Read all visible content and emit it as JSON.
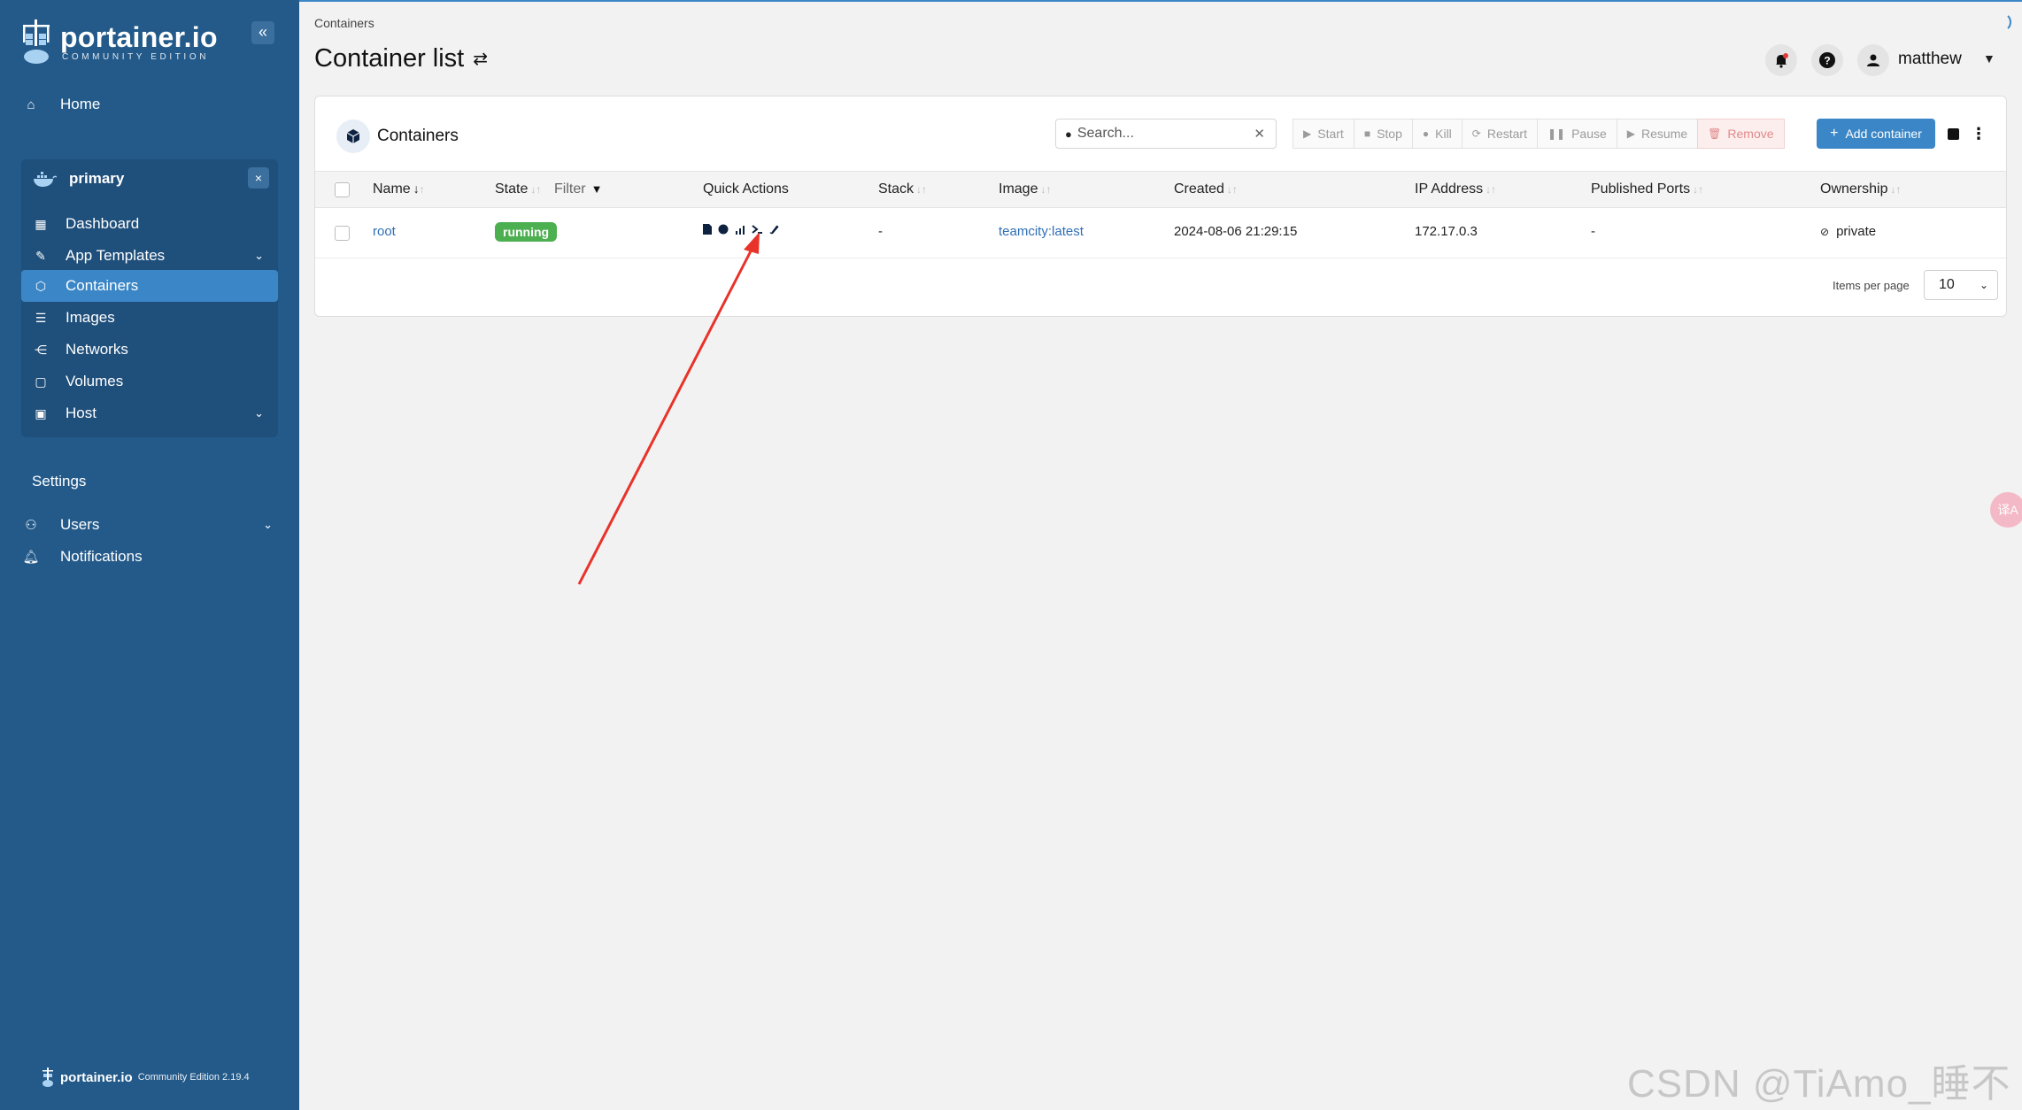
{
  "sidebar": {
    "logo_name": "portainer.io",
    "logo_sub": "COMMUNITY EDITION",
    "collapse_glyph": "«",
    "home_label": "Home",
    "environment": {
      "name": "primary",
      "close_glyph": "×",
      "items": [
        {
          "label": "Dashboard",
          "icon": "dashboard-icon"
        },
        {
          "label": "App Templates",
          "icon": "templates-icon",
          "expandable": true
        },
        {
          "label": "Containers",
          "icon": "cube-icon",
          "active": true
        },
        {
          "label": "Images",
          "icon": "list-icon"
        },
        {
          "label": "Networks",
          "icon": "network-icon"
        },
        {
          "label": "Volumes",
          "icon": "volume-icon"
        },
        {
          "label": "Host",
          "icon": "host-icon",
          "expandable": true
        }
      ]
    },
    "settings_title": "Settings",
    "settings_items": [
      {
        "label": "Users",
        "icon": "users-icon",
        "expandable": true
      },
      {
        "label": "Notifications",
        "icon": "bell-icon"
      }
    ],
    "footer": {
      "name": "portainer.io",
      "version": "Community Edition 2.19.4"
    }
  },
  "header": {
    "breadcrumb": "Containers",
    "title": "Container list",
    "user": "matthew"
  },
  "card": {
    "title": "Containers",
    "search_placeholder": "Search...",
    "actions": [
      {
        "label": "Start",
        "icon": "▶"
      },
      {
        "label": "Stop",
        "icon": "■"
      },
      {
        "label": "Kill",
        "icon": "●"
      },
      {
        "label": "Restart",
        "icon": "⟳"
      },
      {
        "label": "Pause",
        "icon": "❚❚"
      },
      {
        "label": "Resume",
        "icon": "▶"
      },
      {
        "label": "Remove",
        "icon": "🗑"
      }
    ],
    "add_label": "Add container",
    "columns": {
      "name": "Name",
      "state": "State",
      "filter": "Filter",
      "quick_actions": "Quick Actions",
      "stack": "Stack",
      "image": "Image",
      "created": "Created",
      "ip": "IP Address",
      "ports": "Published Ports",
      "ownership": "Ownership"
    },
    "rows": [
      {
        "name": "root",
        "state": "running",
        "stack": "-",
        "image": "teamcity:latest",
        "created": "2024-08-06 21:29:15",
        "ip": "172.17.0.3",
        "ports": "-",
        "ownership": "private"
      }
    ],
    "items_per_page_label": "Items per page",
    "items_per_page_value": "10"
  },
  "watermark": "CSDN @TiAmo_睡不醒",
  "translate_label": "译A",
  "colors": {
    "sidebar": "#235a8a",
    "accent": "#3b86c6",
    "running": "#4caf50",
    "annotation": "#e8332a"
  }
}
